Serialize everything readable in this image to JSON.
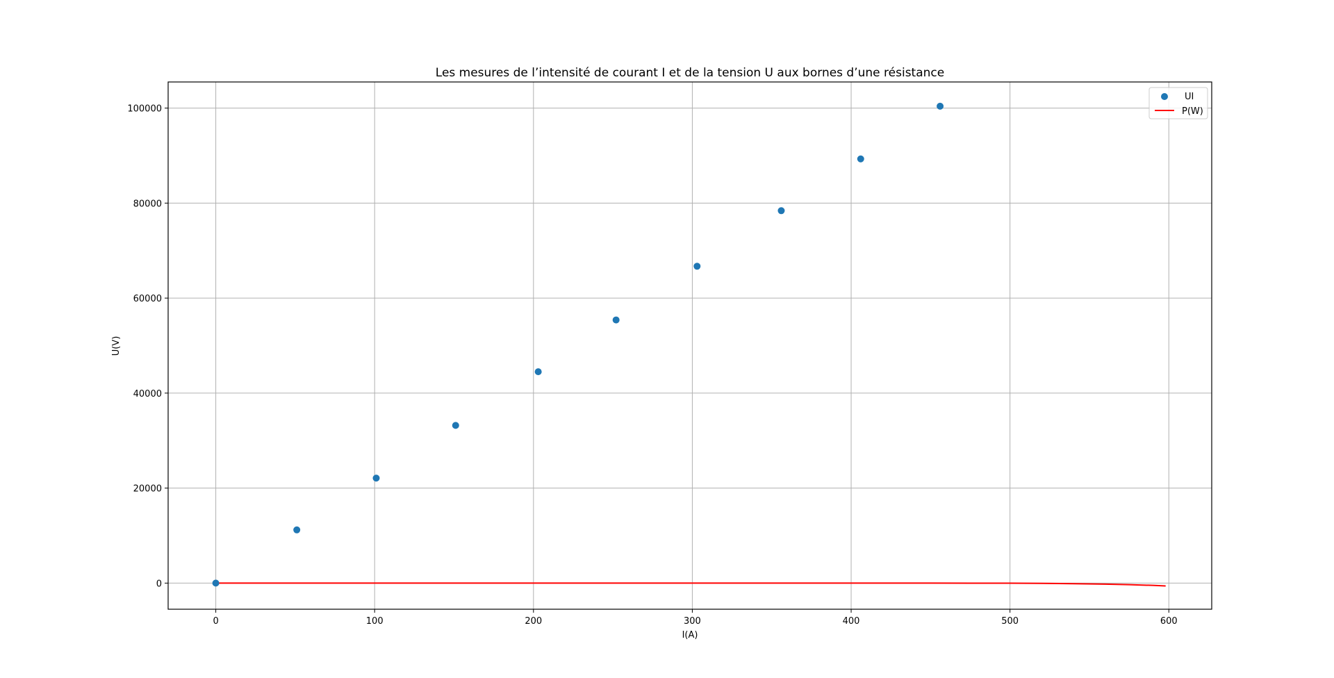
{
  "chart_data": {
    "type": "scatter",
    "title": "Les mesures de l’intensité de courant I et de la tension U aux bornes d’une résistance",
    "xlabel": "I(A)",
    "ylabel": "U(V)",
    "xlim": [
      -30,
      627
    ],
    "ylim": [
      -5500,
      105500
    ],
    "xticks": [
      0,
      100,
      200,
      300,
      400,
      500,
      600
    ],
    "yticks": [
      0,
      20000,
      40000,
      60000,
      80000,
      100000
    ],
    "grid": true,
    "legend": {
      "placement": "upper-right",
      "entries": [
        "UI",
        "P(W)"
      ]
    },
    "colors": {
      "scatter": "#1f77b4",
      "line": "#ff0000"
    },
    "series": [
      {
        "name": "UI",
        "kind": "scatter",
        "x": [
          0,
          51,
          101,
          151,
          203,
          252,
          303,
          356,
          406,
          456
        ],
        "y": [
          0,
          11200,
          22100,
          33200,
          44500,
          55400,
          66700,
          78400,
          89300,
          100400
        ]
      },
      {
        "name": "P(W)",
        "kind": "line",
        "x": [
          0,
          50,
          100,
          150,
          200,
          250,
          300,
          350,
          400,
          450,
          500,
          520,
          540,
          560,
          575,
          590,
          598
        ],
        "y": [
          0,
          0,
          0,
          0,
          0,
          0,
          0,
          0,
          0,
          0,
          -20,
          -60,
          -120,
          -220,
          -330,
          -480,
          -600
        ]
      }
    ]
  }
}
